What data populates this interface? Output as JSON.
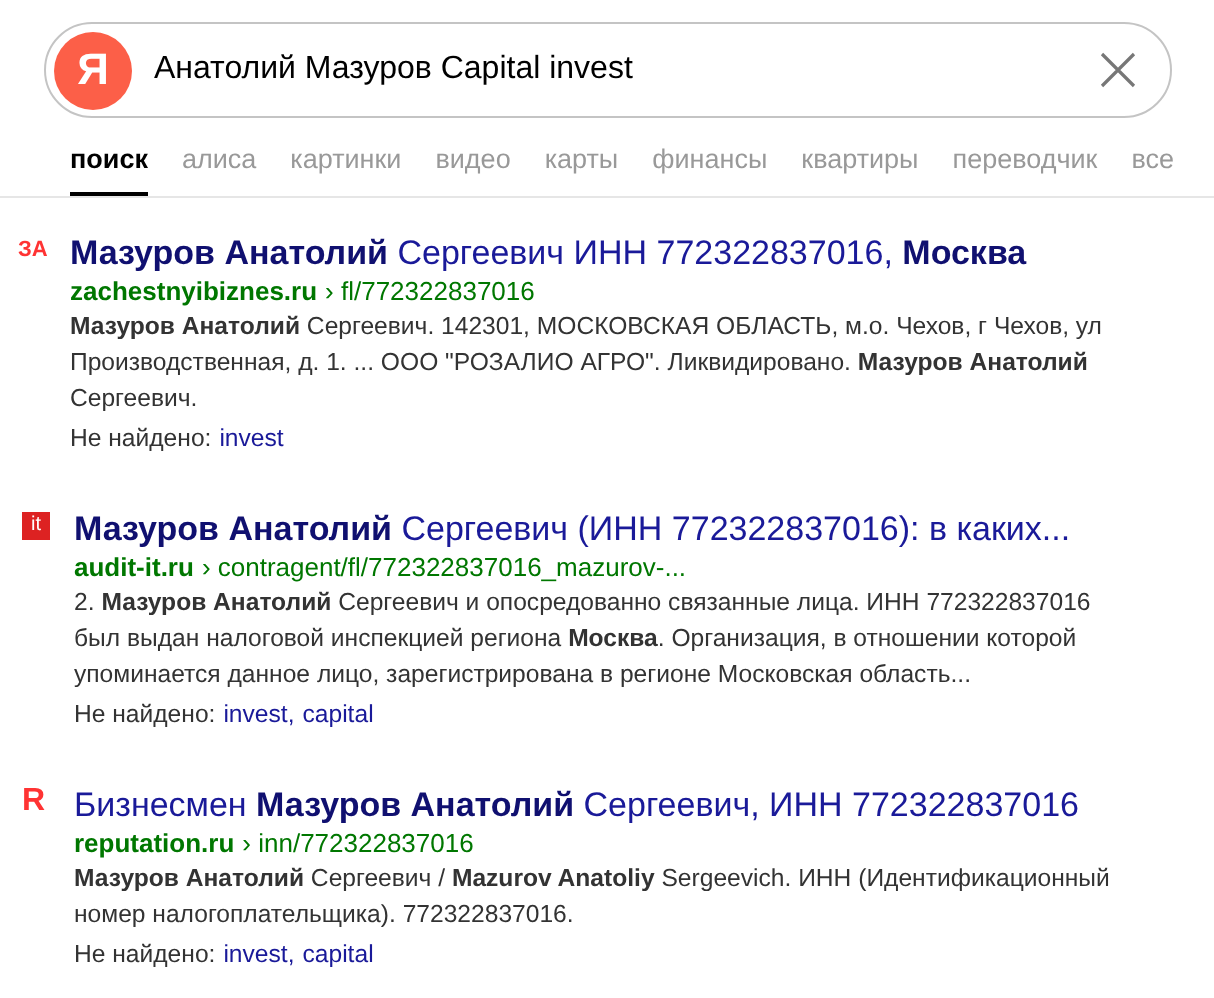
{
  "search": {
    "logo": "Я",
    "value": "Анатолий Мазуров Capital invest"
  },
  "tabs": [
    {
      "label": "поиск",
      "selected": true
    },
    {
      "label": "алиса",
      "selected": false
    },
    {
      "label": "картинки",
      "selected": false
    },
    {
      "label": "видео",
      "selected": false
    },
    {
      "label": "карты",
      "selected": false
    },
    {
      "label": "финансы",
      "selected": false
    },
    {
      "label": "квартиры",
      "selected": false
    },
    {
      "label": "переводчик",
      "selected": false
    },
    {
      "label": "все",
      "selected": false
    }
  ],
  "results": [
    {
      "favicon": {
        "kind": "plain",
        "text": "ЗА"
      },
      "title": "**Мазуров Анатолий** Сергеевич ИНН 772322837016, **Москва**",
      "domain": "zachestnyibiznes.ru",
      "path": "› fl/772322837016",
      "snippet": "**Мазуров Анатолий** Сергеевич. 142301, МОСКОВСКАЯ ОБЛАСТЬ, м.о. Чехов, г Чехов, ул Производственная, д. 1. ... ООО \"РОЗАЛИО АГРО\". Ликвидировано. **Мазуров Анатолий** Сергеевич.",
      "missing_label": "Не найдено:",
      "missing": [
        "invest"
      ]
    },
    {
      "favicon": {
        "kind": "tile",
        "text": "it"
      },
      "title": "**Мазуров Анатолий** Сергеевич (ИНН 772322837016): в каких...",
      "domain": "audit-it.ru",
      "path": "› contragent/fl/772322837016_mazurov-...",
      "snippet": "2. **Мазуров Анатолий** Сергеевич и опосредованно связанные лица. ИНН 772322837016 был выдан налоговой инспекцией региона **Москва**. Организация, в отношении которой упоминается данное лицо, зарегистрирована в регионе Московская область...",
      "missing_label": "Не найдено:",
      "missing": [
        "invest,",
        "capital"
      ]
    },
    {
      "favicon": {
        "kind": "plain",
        "text": "R"
      },
      "title": "Бизнесмен **Мазуров Анатолий** Сергеевич, ИНН 772322837016",
      "domain": "reputation.ru",
      "path": "› inn/772322837016",
      "snippet": "**Мазуров Анатолий** Сергеевич / **Mazurov Anatoliy** Sergeevich. ИНН (Идентификационный номер налогоплательщика). 772322837016.",
      "missing_label": "Не найдено:",
      "missing": [
        "invest,",
        "capital"
      ]
    }
  ]
}
